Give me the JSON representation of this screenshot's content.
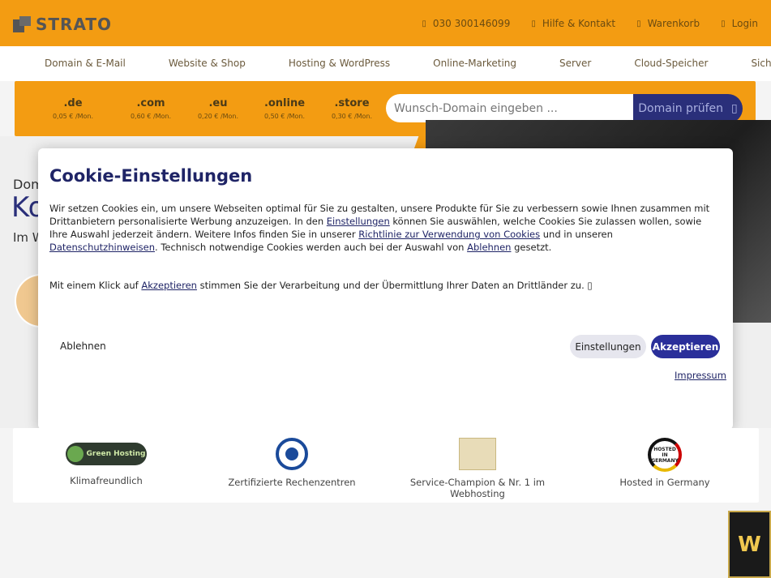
{
  "brand": {
    "name": "STRATO"
  },
  "topbar": {
    "links": [
      {
        "icon": "phone-icon",
        "label": "030 300146099"
      },
      {
        "icon": "help-icon",
        "label": "Hilfe & Kontakt"
      },
      {
        "icon": "cart-icon",
        "label": "Warenkorb"
      },
      {
        "icon": "user-icon",
        "label": "Login"
      }
    ]
  },
  "nav": {
    "items": [
      "Domain & E-Mail",
      "Website & Shop",
      "Hosting & WordPress",
      "Online-Marketing",
      "Server",
      "Cloud-Speicher",
      "Sicherheit"
    ]
  },
  "domain_search": {
    "tlds": [
      {
        "name": ".de",
        "price": "0,05 € /Mon."
      },
      {
        "name": ".com",
        "price": "0,60 € /Mon."
      },
      {
        "name": ".eu",
        "price": "0,20 € /Mon."
      },
      {
        "name": ".online",
        "price": "0,50 € /Mon."
      },
      {
        "name": ".store",
        "price": "0,30 € /Mon."
      }
    ],
    "placeholder": "Wunsch-Domain eingeben ...",
    "button_label": "Domain prüfen"
  },
  "hero": {
    "line1": "Dom",
    "line2": "Ko",
    "line3": "Im W"
  },
  "cookie_modal": {
    "title": "Cookie-Einstellungen",
    "p1_a": "Wir setzen Cookies ein, um unsere Webseiten optimal für Sie zu gestalten, unsere Produkte für Sie zu verbessern sowie Ihnen zusammen mit Drittanbietern personalisierte Werbung anzuzeigen. In den ",
    "p1_link1": "Einstellungen",
    "p1_b": " können Sie auswählen, welche Cookies Sie zulassen wollen, sowie Ihre Auswahl jederzeit ändern. Weitere Infos finden Sie in unserer ",
    "p1_link2": "Richtlinie zur Verwendung von Cookies",
    "p1_c": " und in unseren ",
    "p1_link3": "Datenschutzhinweisen",
    "p1_d": ". Technisch notwendige Cookies werden auch bei der Auswahl von ",
    "p1_link4": "Ablehnen",
    "p1_e": " gesetzt.",
    "p2_a": "Mit einem Klick auf ",
    "p2_link": "Akzeptieren",
    "p2_b": " stimmen Sie der Verarbeitung und der Übermittlung Ihrer Daten an Drittländer zu. ",
    "btn_reject": "Ablehnen",
    "btn_settings": "Einstellungen",
    "btn_accept": "Akzeptieren",
    "impressum": "Impressum"
  },
  "features": [
    {
      "logo": "Green Hosting",
      "label": "Klimafreundlich"
    },
    {
      "logo": "",
      "label": "Zertifizierte Rechenzentren"
    },
    {
      "logo": "",
      "label": "Service-Champion & Nr. 1 im Webhosting"
    },
    {
      "logo": "HOSTED IN GERMANY",
      "label": "Hosted in Germany"
    }
  ],
  "colors": {
    "brand_orange": "#f39c12",
    "brand_navy": "#2a2f7a",
    "accept_button": "#2a2f9a"
  }
}
